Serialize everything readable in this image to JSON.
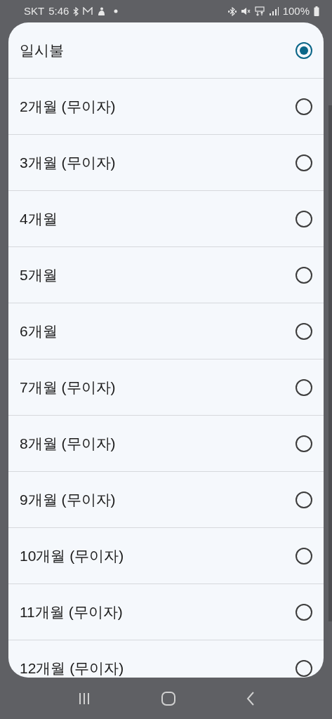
{
  "status_bar": {
    "carrier": "SKT",
    "time": "5:46",
    "battery": "100%"
  },
  "options": [
    {
      "label": "일시불",
      "selected": true
    },
    {
      "label": "2개월 (무이자)",
      "selected": false
    },
    {
      "label": "3개월 (무이자)",
      "selected": false
    },
    {
      "label": "4개월",
      "selected": false
    },
    {
      "label": "5개월",
      "selected": false
    },
    {
      "label": "6개월",
      "selected": false
    },
    {
      "label": "7개월 (무이자)",
      "selected": false
    },
    {
      "label": "8개월 (무이자)",
      "selected": false
    },
    {
      "label": "9개월 (무이자)",
      "selected": false
    },
    {
      "label": "10개월 (무이자)",
      "selected": false
    },
    {
      "label": "11개월 (무이자)",
      "selected": false
    },
    {
      "label": "12개월 (무이자)",
      "selected": false
    }
  ]
}
